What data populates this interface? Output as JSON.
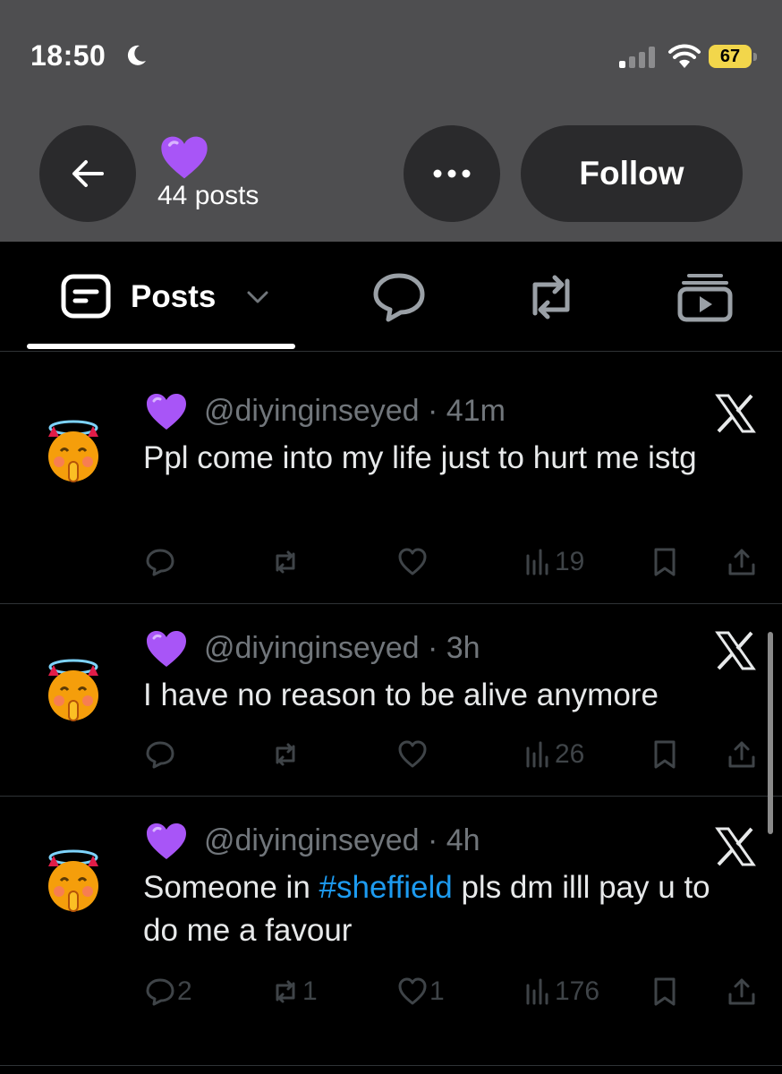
{
  "status_bar": {
    "time": "18:50",
    "battery": "67"
  },
  "header": {
    "post_count": "44 posts",
    "follow_label": "Follow"
  },
  "tabs": {
    "posts_label": "Posts"
  },
  "tweets": [
    {
      "handle": "@diyinginseyed",
      "time": "41m",
      "text": "Ppl come into my life just to hurt me istg",
      "replies": "",
      "reposts": "",
      "likes": "",
      "views": "19"
    },
    {
      "handle": "@diyinginseyed",
      "time": "3h",
      "text": "I have no reason to be alive anymore",
      "replies": "",
      "reposts": "",
      "likes": "",
      "views": "26"
    },
    {
      "handle": "@diyinginseyed",
      "time": "4h",
      "text_before": "Someone in ",
      "hashtag": "#sheffield",
      "text_after": " pls dm illl pay u to do me a favour",
      "replies": "2",
      "reposts": "1",
      "likes": "1",
      "views": "176"
    }
  ],
  "colors": {
    "header_bg": "#4e4e50",
    "background": "#000000",
    "hashtag": "#1d9bf0",
    "battery": "#f2d64b",
    "heart": "#a855f7"
  },
  "icons": [
    "back-arrow-icon",
    "more-icon",
    "purple-heart-icon",
    "posts-icon",
    "reply-bubble-icon",
    "repost-icon",
    "media-icon",
    "angel-devil-emoji-icon",
    "x-logo-icon",
    "reply-icon",
    "like-icon",
    "views-icon",
    "bookmark-icon",
    "share-icon"
  ]
}
